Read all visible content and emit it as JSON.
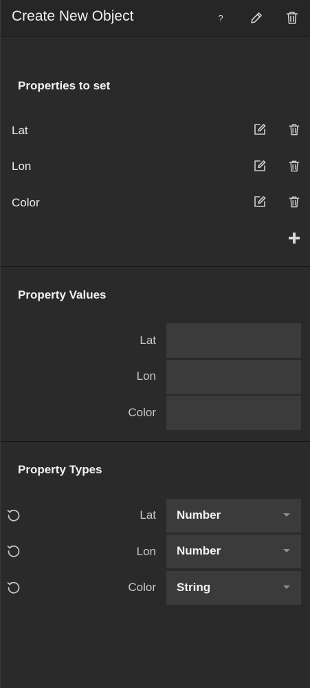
{
  "header": {
    "title": "Create New Object",
    "help_label": "?",
    "edit_icon": "pencil-icon",
    "delete_icon": "trash-icon"
  },
  "properties_to_set": {
    "title": "Properties to set",
    "items": [
      {
        "label": "Lat"
      },
      {
        "label": "Lon"
      },
      {
        "label": "Color"
      }
    ],
    "row_edit_icon": "edit-square-icon",
    "row_delete_icon": "trash-icon",
    "add_icon": "plus-icon"
  },
  "property_values": {
    "title": "Property Values",
    "fields": [
      {
        "label": "Lat",
        "value": ""
      },
      {
        "label": "Lon",
        "value": ""
      },
      {
        "label": "Color",
        "value": ""
      }
    ]
  },
  "property_types": {
    "title": "Property Types",
    "fields": [
      {
        "label": "Lat",
        "type": "Number"
      },
      {
        "label": "Lon",
        "type": "Number"
      },
      {
        "label": "Color",
        "type": "String"
      }
    ],
    "reset_icon": "reset-icon"
  },
  "colors": {
    "panel_bg": "#2a2a2a",
    "header_bg": "#262626",
    "input_bg": "#3b3b3b",
    "text": "#ececec",
    "muted_text": "#c9c9c9"
  }
}
